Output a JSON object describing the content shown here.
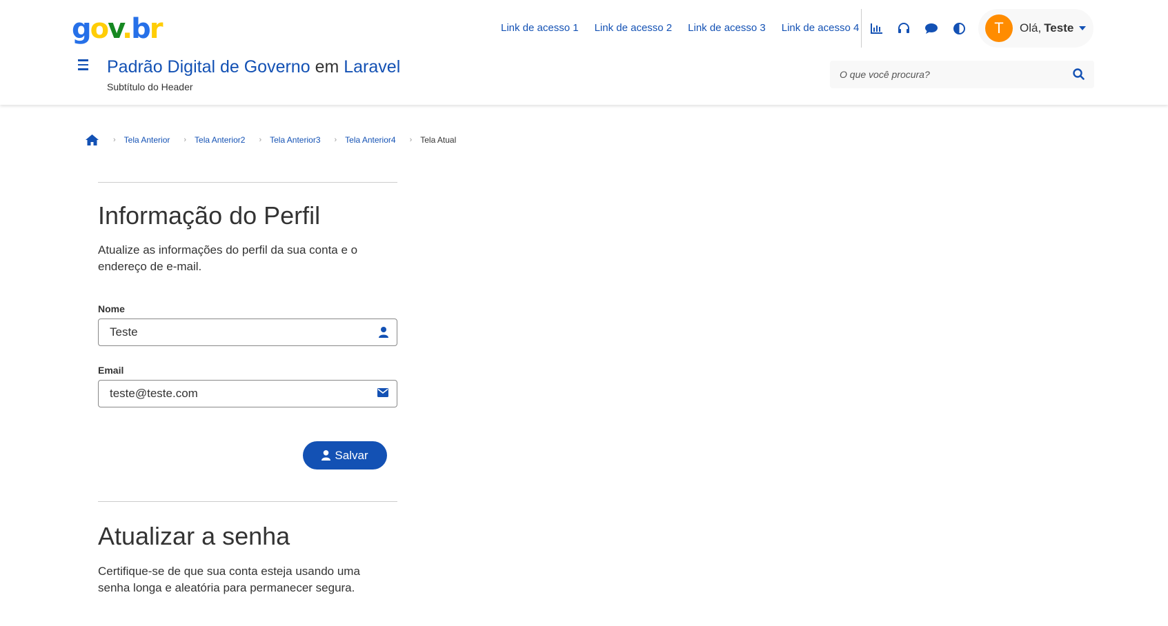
{
  "header": {
    "logo": {
      "g": "g",
      "o": "o",
      "v": "v",
      "dot": ".",
      "b": "b",
      "r": "r"
    },
    "quick_links": [
      "Link de acesso 1",
      "Link de acesso 2",
      "Link de acesso 3",
      "Link de acesso 4"
    ],
    "icons": [
      "chart-icon",
      "headset-icon",
      "chat-icon",
      "contrast-icon"
    ],
    "user": {
      "avatar_initial": "T",
      "greeting": "Olá,",
      "name": "Teste"
    },
    "title_part1": "Padrão Digital de Governo",
    "title_em": " em ",
    "title_part2": "Laravel",
    "subtitle": "Subtítulo do Header",
    "search_placeholder": "O que você procura?"
  },
  "breadcrumb": {
    "items": [
      "Tela Anterior",
      "Tela Anterior2",
      "Tela Anterior3",
      "Tela Anterior4"
    ],
    "current": "Tela Atual"
  },
  "profile": {
    "title": "Informação do Perfil",
    "description": "Atualize as informações do perfil da sua conta e o endereço de e-mail.",
    "name_label": "Nome",
    "name_value": "Teste",
    "email_label": "Email",
    "email_value": "teste@teste.com",
    "save_label": "Salvar"
  },
  "password": {
    "title": "Atualizar a senha",
    "description": "Certifique-se de que sua conta esteja usando uma senha longa e aleatória para permanecer segura."
  },
  "colors": {
    "primary": "#1351b4",
    "avatar": "#ff8c00"
  }
}
